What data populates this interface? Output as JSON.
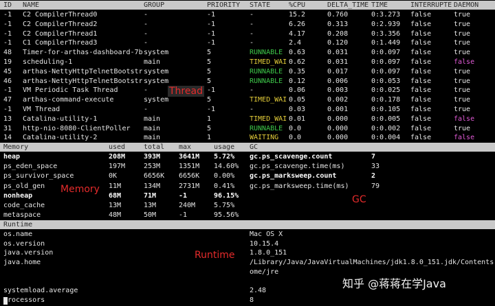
{
  "thread": {
    "headers": [
      "ID",
      "NAME",
      "GROUP",
      "PRIORITY",
      "STATE",
      "%CPU",
      "DELTA_TIME",
      "TIME",
      "INTERRUPTE",
      "DAEMON"
    ],
    "rows": [
      [
        "-1",
        "C2 CompilerThread0",
        "-",
        "-1",
        "-",
        "15.2",
        "0.760",
        "0:3.273",
        "false",
        "true"
      ],
      [
        "-1",
        "C2 CompilerThread2",
        "-",
        "-1",
        "-",
        "6.26",
        "0.313",
        "0:2.939",
        "false",
        "true"
      ],
      [
        "-1",
        "C2 CompilerThread1",
        "-",
        "-1",
        "-",
        "4.17",
        "0.208",
        "0:3.356",
        "false",
        "true"
      ],
      [
        "-1",
        "C1 CompilerThread3",
        "-",
        "-1",
        "-",
        "2.4",
        "0.120",
        "0:1.449",
        "false",
        "true"
      ],
      [
        "48",
        "Timer-for-arthas-dashboard-7b1",
        "system",
        "5",
        "RUNNABLE",
        "0.63",
        "0.031",
        "0:0.097",
        "false",
        "true"
      ],
      [
        "19",
        "scheduling-1",
        "main",
        "5",
        "TIMED_WAI",
        "0.62",
        "0.031",
        "0:0.097",
        "false",
        "false"
      ],
      [
        "45",
        "arthas-NettyHttpTelnetBootstra",
        "system",
        "5",
        "RUNNABLE",
        "0.35",
        "0.017",
        "0:0.097",
        "false",
        "true"
      ],
      [
        "46",
        "arthas-NettyHttpTelnetBootstra",
        "system",
        "5",
        "RUNNABLE",
        "0.12",
        "0.006",
        "0:0.053",
        "false",
        "true"
      ],
      [
        "-1",
        "VM Periodic Task Thread",
        "-",
        "-1",
        "-",
        "0.06",
        "0.003",
        "0:0.025",
        "false",
        "true"
      ],
      [
        "47",
        "arthas-command-execute",
        "system",
        "5",
        "TIMED_WAI",
        "0.05",
        "0.002",
        "0:0.178",
        "false",
        "true"
      ],
      [
        "-1",
        "VM Thread",
        "-",
        "-1",
        "-",
        "0.03",
        "0.001",
        "0:0.105",
        "false",
        "true"
      ],
      [
        "13",
        "Catalina-utility-1",
        "main",
        "1",
        "TIMED_WAI",
        "0.01",
        "0.000",
        "0:0.005",
        "false",
        "false"
      ],
      [
        "31",
        "http-nio-8080-ClientPoller",
        "main",
        "5",
        "RUNNABLE",
        "0.0",
        "0.000",
        "0:0.002",
        "false",
        "true"
      ],
      [
        "14",
        "Catalina-utility-2",
        "main",
        "1",
        "WAITING",
        "0.0",
        "0.000",
        "0:0.004",
        "false",
        "false"
      ]
    ]
  },
  "memory": {
    "headers": [
      "Memory",
      "used",
      "total",
      "max",
      "usage"
    ],
    "rows": [
      [
        "heap",
        "208M",
        "393M",
        "3641M",
        "5.72%"
      ],
      [
        "ps_eden_space",
        "197M",
        "253M",
        "1351M",
        "14.60%"
      ],
      [
        "ps_survivor_space",
        "0K",
        "6656K",
        "6656K",
        "0.00%"
      ],
      [
        "ps_old_gen",
        "11M",
        "134M",
        "2731M",
        "0.41%"
      ],
      [
        "nonheap",
        "68M",
        "71M",
        "-1",
        "96.15%"
      ],
      [
        "code_cache",
        "13M",
        "13M",
        "240M",
        "5.75%"
      ],
      [
        "metaspace",
        "48M",
        "50M",
        "-1",
        "95.56%"
      ]
    ]
  },
  "gc": {
    "header": "GC",
    "rows": [
      [
        "gc.ps_scavenge.count",
        "7"
      ],
      [
        "gc.ps_scavenge.time(ms)",
        "33"
      ],
      [
        "gc.ps_marksweep.count",
        "2"
      ],
      [
        "gc.ps_marksweep.time(ms)",
        "79"
      ]
    ]
  },
  "runtime": {
    "header": "Runtime",
    "rows": [
      [
        "os.name",
        "Mac OS X"
      ],
      [
        "os.version",
        "10.15.4"
      ],
      [
        "java.version",
        "1.8.0_151"
      ],
      [
        "java.home",
        "/Library/Java/JavaVirtualMachines/jdk1.8.0_151.jdk/Contents/H"
      ],
      [
        "",
        "ome/jre"
      ],
      [
        "",
        ""
      ],
      [
        "systemload.average",
        "2.48"
      ],
      [
        "processors",
        "8"
      ]
    ]
  },
  "annotations": {
    "thread": "Thread",
    "memory": "Memory",
    "gc": "GC",
    "runtime": "Runtime"
  },
  "watermark": "知乎 @蒋蒋在学Java",
  "colors": {
    "header_bar": "#c9c9c9",
    "background": "#000000",
    "runnable": "#3ec94a",
    "timed_waiting": "#e6cf3a",
    "daemon_false": "#e05ad6",
    "annotation": "#e52b2b"
  }
}
